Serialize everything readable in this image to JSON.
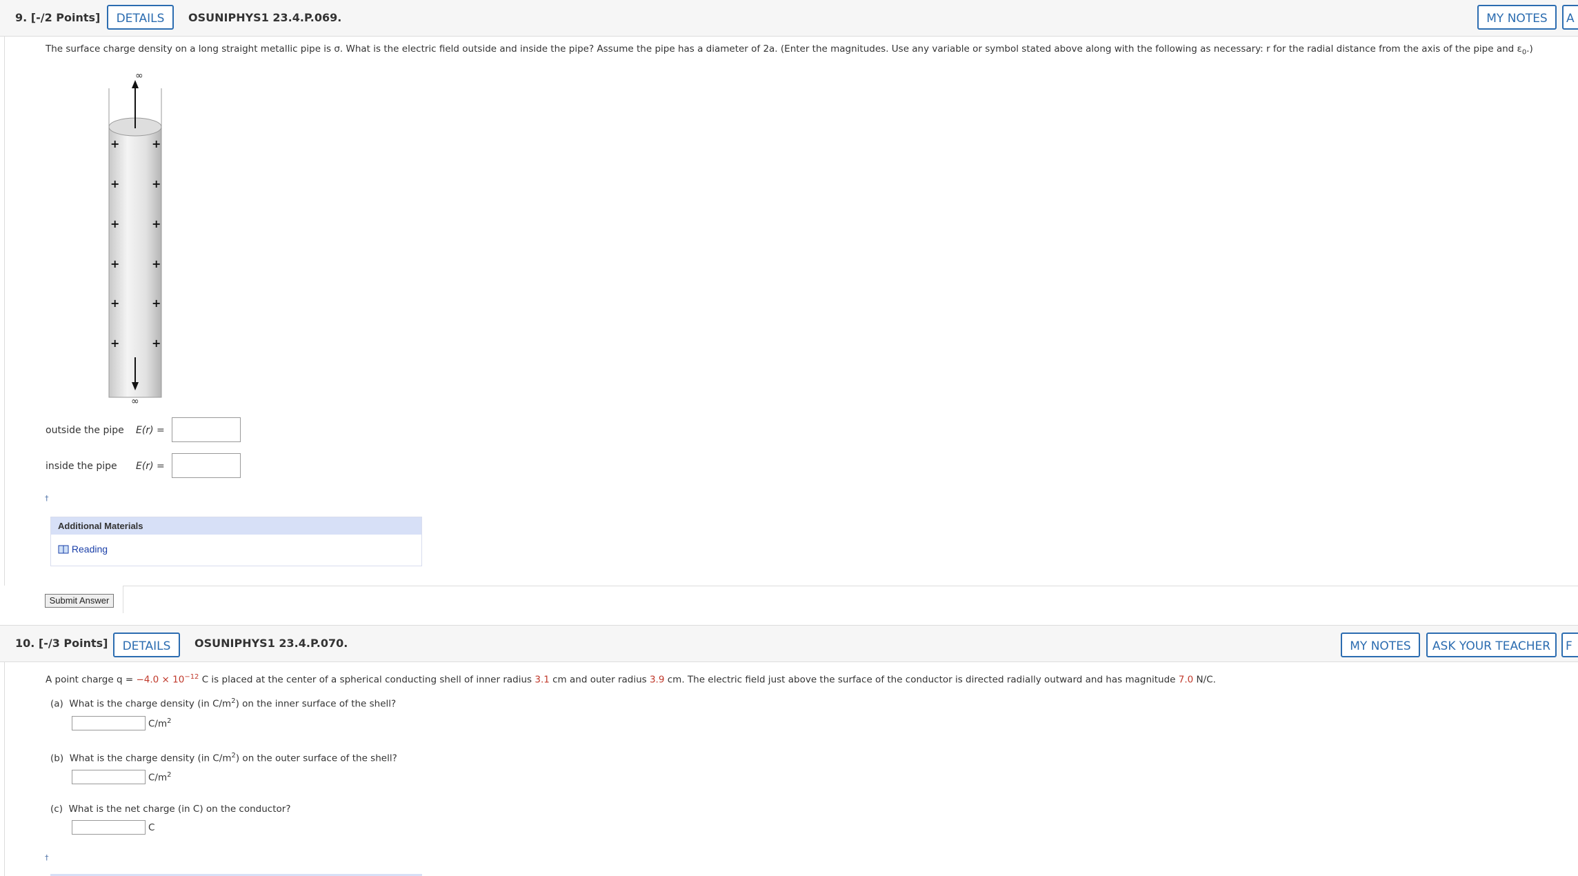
{
  "q9": {
    "points": "9. [-/2 Points]",
    "details": "DETAILS",
    "id": "OSUNIPHYS1 23.4.P.069.",
    "my_notes": "MY NOTES",
    "ask_partial": "A",
    "prompt_pre": "The surface charge density on a long straight metallic pipe is σ. What is the electric field outside and inside the pipe? Assume the pipe has a diameter of 2a. (Enter the magnitudes. Use any variable or symbol stated above along with the following as necessary: r for the radial distance from the axis of the pipe and ε",
    "prompt_sub": "0",
    "prompt_post": ".)",
    "figure": {
      "infinity_top": "∞",
      "infinity_bottom": "∞",
      "plus_sign": "+"
    },
    "outside_label": "outside the pipe",
    "inside_label": "inside the pipe",
    "er_label": "E(r)  =",
    "tip_marker": "†",
    "additional_materials": "Additional Materials",
    "reading": "Reading",
    "submit": "Submit Answer"
  },
  "q10": {
    "points": "10. [-/3 Points]",
    "details": "DETAILS",
    "id": "OSUNIPHYS1 23.4.P.070.",
    "my_notes": "MY NOTES",
    "ask_teacher": "ASK YOUR TEACHER",
    "partial": "F",
    "prompt": {
      "p1": "A point charge q = ",
      "q_value": "−4.0 × 10",
      "q_exp": "−12",
      "p2": " C is placed at the center of a spherical conducting shell of inner radius ",
      "r_inner": "3.1",
      "p3": " cm and outer radius ",
      "r_outer": "3.9",
      "p4": " cm. The electric field just above the surface of the conductor is directed radially outward and has magnitude ",
      "e_mag": "7.0",
      "p5": " N/C."
    },
    "part_a": {
      "tag": "(a)",
      "q_pre": "What is the charge density (in C/m",
      "q_exp": "2",
      "q_post": ") on the inner surface of the shell?",
      "unit": "C/m",
      "unit_exp": "2"
    },
    "part_b": {
      "tag": "(b)",
      "q_pre": "What is the charge density (in C/m",
      "q_exp": "2",
      "q_post": ") on the outer surface of the shell?",
      "unit": "C/m",
      "unit_exp": "2"
    },
    "part_c": {
      "tag": "(c)",
      "q": "What is the net charge (in C) on the conductor?",
      "unit": "C"
    },
    "tip_marker": "†"
  }
}
